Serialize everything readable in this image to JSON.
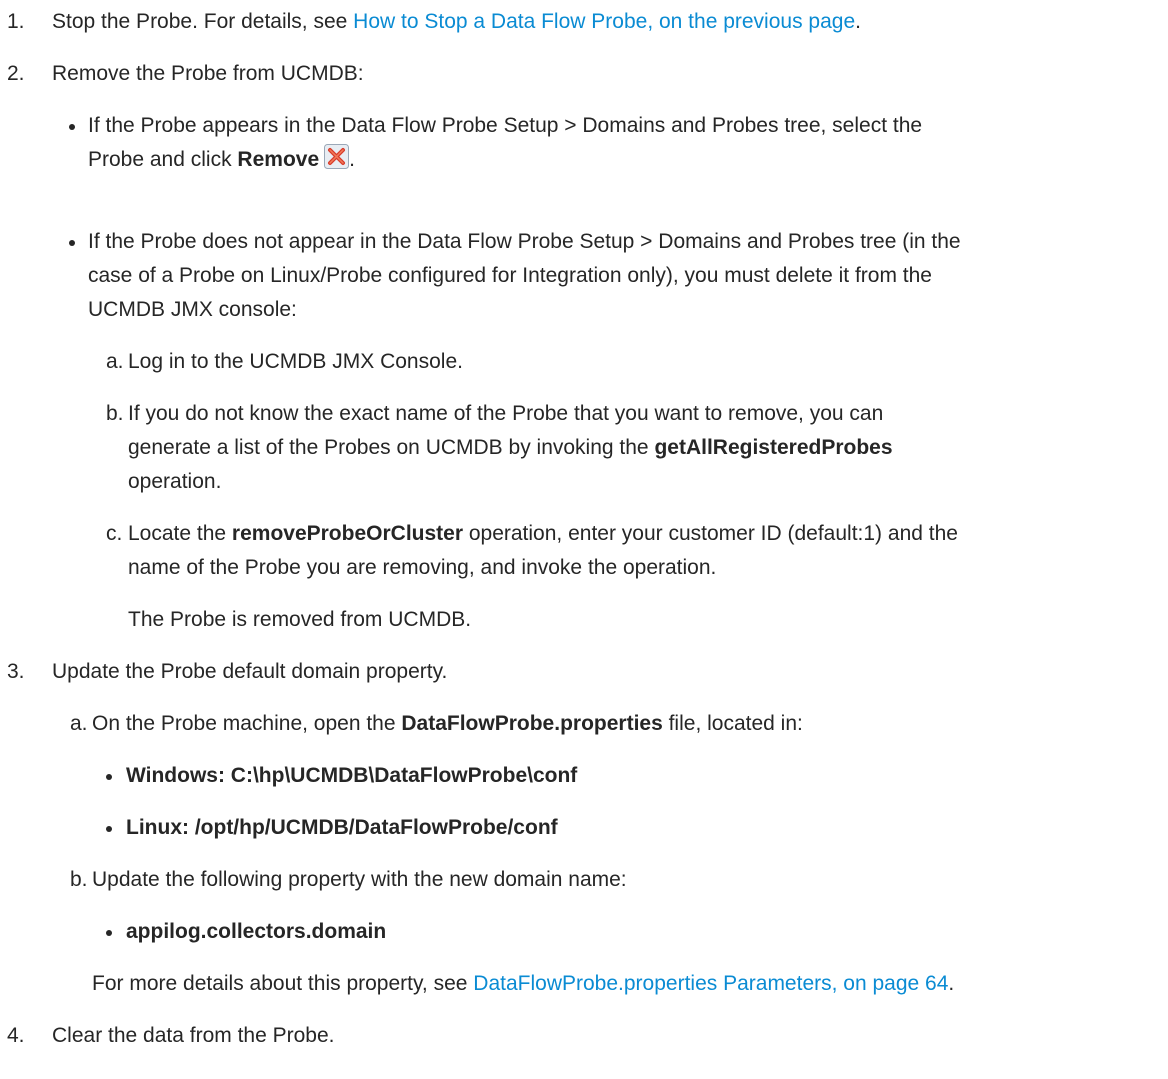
{
  "steps": [
    {
      "num": "1.",
      "text": "Stop the Probe. For details, see ",
      "link": "How to Stop a Data Flow Probe, on the previous page",
      "end": "."
    },
    {
      "num": "2.",
      "text": "Remove the Probe from UCMDB:",
      "bullets": [
        {
          "line1": "If the Probe appears in the Data Flow Probe Setup > Domains and Probes tree, select the",
          "line2_pre": "Probe and click ",
          "line2_bold": "Remove",
          "line2_end": ".",
          "icon": "remove-icon"
        },
        {
          "lines": [
            "If the Probe does not appear in the Data Flow Probe Setup > Domains and Probes tree (in the",
            "case of a Probe on Linux/Probe configured for Integration only), you must delete it from the",
            "UCMDB JMX console:"
          ],
          "substeps": [
            {
              "letter": "a.",
              "text": "Log in to the UCMDB JMX Console."
            },
            {
              "letter": "b.",
              "line1": "If you do not know the exact name of the Probe that you want to remove, you can",
              "line2_pre": "generate a list of the Probes on UCMDB by invoking the ",
              "line2_bold": "getAllRegisteredProbes",
              "line3": "operation."
            },
            {
              "letter": "c.",
              "line1_pre": "Locate the ",
              "line1_bold": "removeProbeOrCluster",
              "line1_post": " operation, enter your customer ID (default:1) and the",
              "line2": "name of the Probe you are removing, and invoke the operation.",
              "note": "The Probe is removed from UCMDB."
            }
          ]
        }
      ]
    },
    {
      "num": "3.",
      "text": "Update the Probe default domain property.",
      "substeps": [
        {
          "letter": "a.",
          "pre": "On the Probe machine, open the ",
          "bold": "DataFlowProbe.properties",
          "post": " file, located in:",
          "bullets": [
            "Windows: C:\\hp\\UCMDB\\DataFlowProbe\\conf",
            "Linux: /opt/hp/UCMDB/DataFlowProbe/conf"
          ]
        },
        {
          "letter": "b.",
          "text": "Update the following property with the new domain name:",
          "bullets": [
            "appilog.collectors.domain"
          ],
          "more_pre": "For more details about this property, see ",
          "more_link": "DataFlowProbe.properties Parameters, on page 64",
          "more_end": "."
        }
      ]
    },
    {
      "num": "4.",
      "text": "Clear the data from the Probe."
    }
  ]
}
